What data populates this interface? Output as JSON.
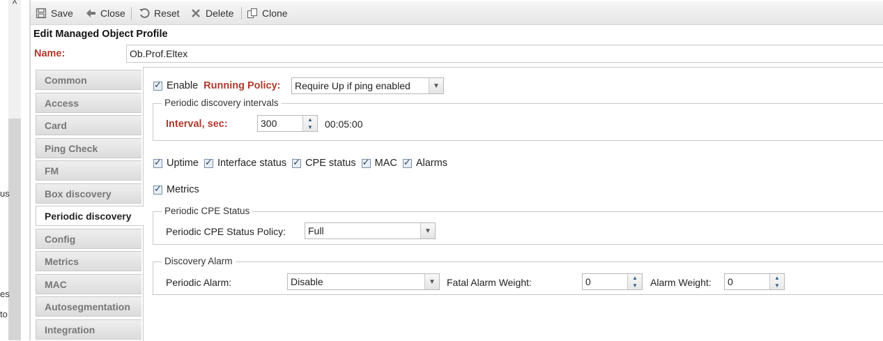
{
  "left_edge": {
    "texts": [
      "us",
      "es",
      "to"
    ]
  },
  "toolbar": {
    "save": "Save",
    "close": "Close",
    "reset": "Reset",
    "delete": "Delete",
    "clone": "Clone"
  },
  "form": {
    "title": "Edit Managed Object Profile",
    "name_label": "Name:",
    "name_value": "Ob.Prof.Eltex"
  },
  "tabs": [
    "Common",
    "Access",
    "Card",
    "Ping Check",
    "FM",
    "Box discovery",
    "Periodic discovery",
    "Config",
    "Metrics",
    "MAC",
    "Autosegmentation",
    "Integration"
  ],
  "active_tab": "Periodic discovery",
  "periodic": {
    "enable_label": "Enable",
    "enable_checked": true,
    "running_policy_label": "Running Policy:",
    "running_policy_value": "Require Up if ping enabled",
    "intervals_legend": "Periodic discovery intervals",
    "interval_label": "Interval, sec:",
    "interval_value": "300",
    "interval_readable": "00:05:00",
    "checks": [
      {
        "label": "Uptime",
        "checked": true
      },
      {
        "label": "Interface status",
        "checked": true
      },
      {
        "label": "CPE status",
        "checked": true
      },
      {
        "label": "MAC",
        "checked": true
      },
      {
        "label": "Alarms",
        "checked": true
      }
    ],
    "metrics_label": "Metrics",
    "metrics_checked": true,
    "cpe_legend": "Periodic CPE Status",
    "cpe_policy_label": "Periodic CPE Status Policy:",
    "cpe_policy_value": "Full",
    "alarm_legend": "Discovery Alarm",
    "periodic_alarm_label": "Periodic Alarm:",
    "periodic_alarm_value": "Disable",
    "fatal_weight_label": "Fatal Alarm Weight:",
    "fatal_weight_value": "0",
    "alarm_weight_label": "Alarm Weight:",
    "alarm_weight_value": "0"
  },
  "colors": {
    "accent_label": "#b03a2e",
    "tab_bg": "#e4e4e4"
  },
  "icons": [
    "save-icon",
    "back-arrow-icon",
    "reset-icon",
    "delete-x-icon",
    "clone-icon",
    "chevron-up-icon",
    "chevron-down-icon"
  ]
}
